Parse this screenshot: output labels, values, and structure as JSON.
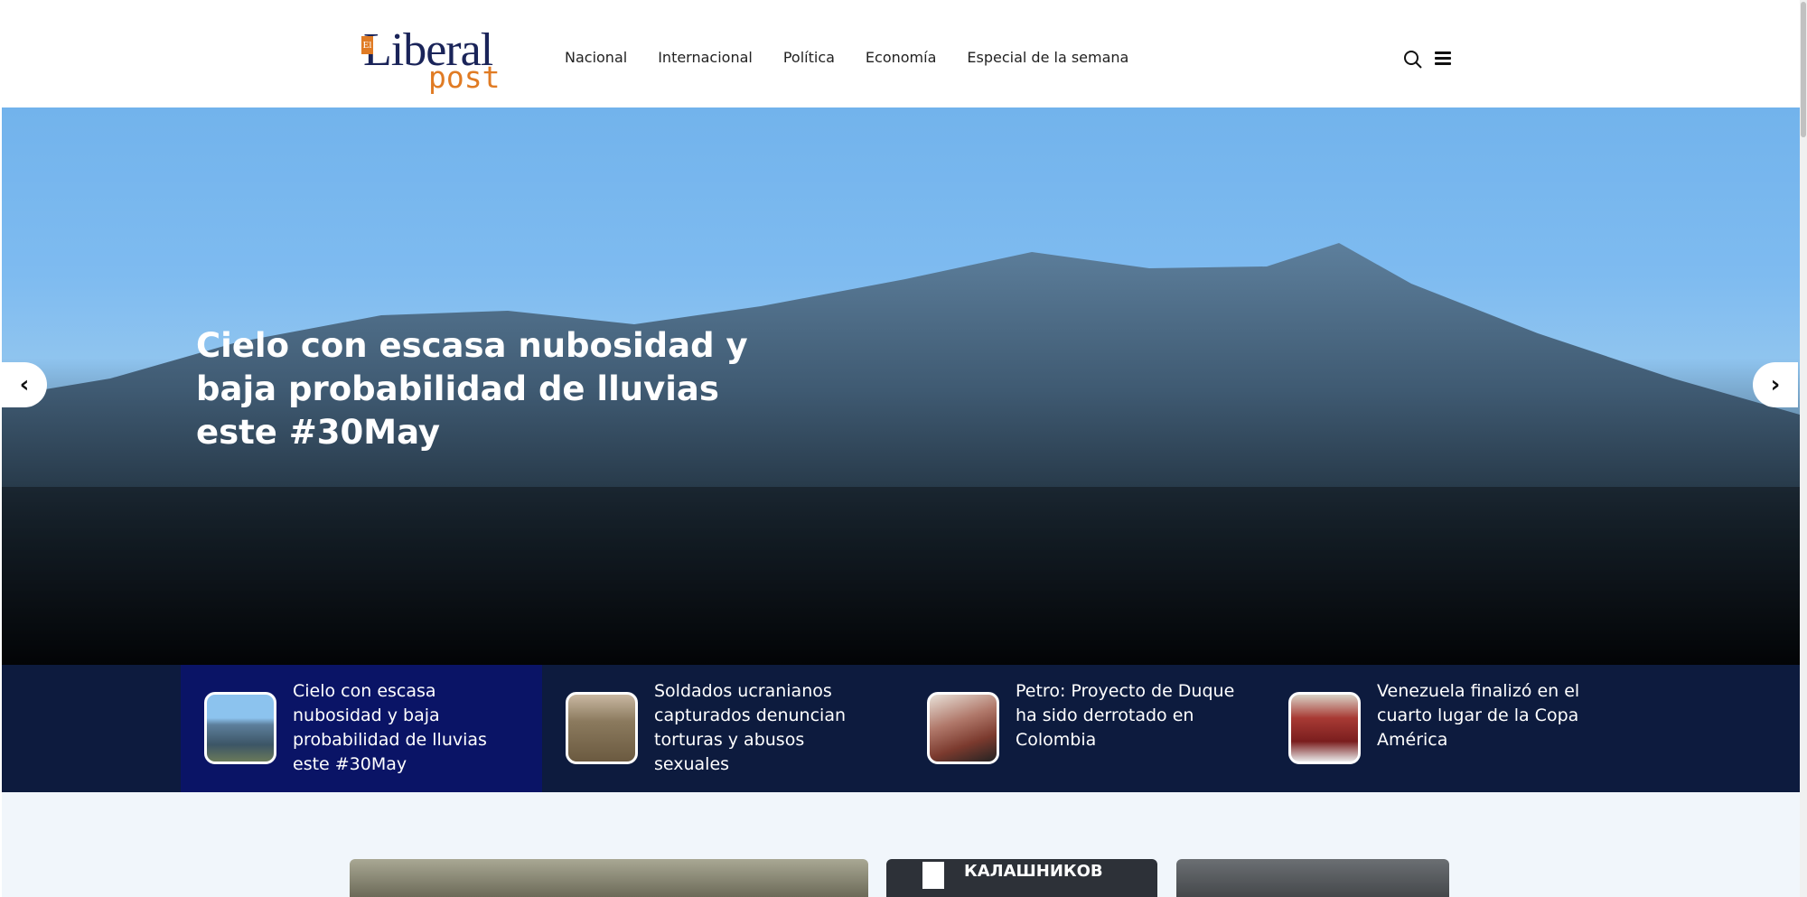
{
  "brand": {
    "logo_prefix": "El",
    "logo_main": "Liberal",
    "logo_sub": "post"
  },
  "nav": {
    "items": [
      "Nacional",
      "Internacional",
      "Política",
      "Economía",
      "Especial de la semana"
    ]
  },
  "hero": {
    "title": "Cielo con escasa nubosidad y baja probabilidad de lluvias este #30May"
  },
  "slider": {
    "prev_icon": "chevron-left-icon",
    "next_icon": "chevron-right-icon",
    "items": [
      {
        "title": "Cielo con escasa nubosidad y baja probabilidad de lluvias este #30May",
        "active": true
      },
      {
        "title": "Soldados ucranianos capturados denuncian torturas y abusos sexuales",
        "active": false
      },
      {
        "title": "Petro: Proyecto de Duque ha sido derrotado en Colombia",
        "active": false
      },
      {
        "title": "Venezuela finalizó en el cuarto lugar de la Copa América",
        "active": false
      }
    ]
  },
  "cards": {
    "card2_text": "КАЛАШНИКОВ"
  },
  "colors": {
    "navy": "#0d1b3e",
    "active": "#0a1466",
    "brand_orange": "#e07b24",
    "brand_navy": "#1a2459"
  }
}
